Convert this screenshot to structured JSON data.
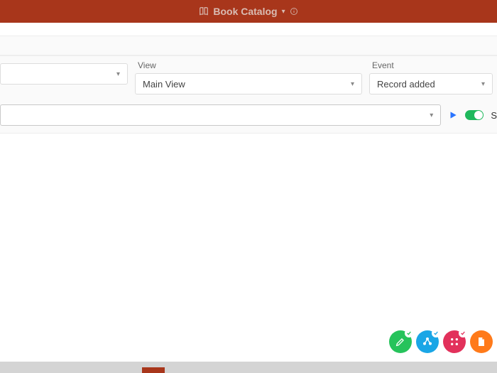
{
  "header": {
    "title": "Book Catalog"
  },
  "row1": {
    "first": {
      "label": "",
      "value": ""
    },
    "view": {
      "label": "View",
      "value": "Main View"
    },
    "event": {
      "label": "Event",
      "value": "Record added"
    }
  },
  "row2": {
    "select_value": "",
    "toggle_letter": "S"
  },
  "fabs": {
    "green": "edit",
    "blue": "share",
    "red": "apps",
    "orange": "file"
  }
}
